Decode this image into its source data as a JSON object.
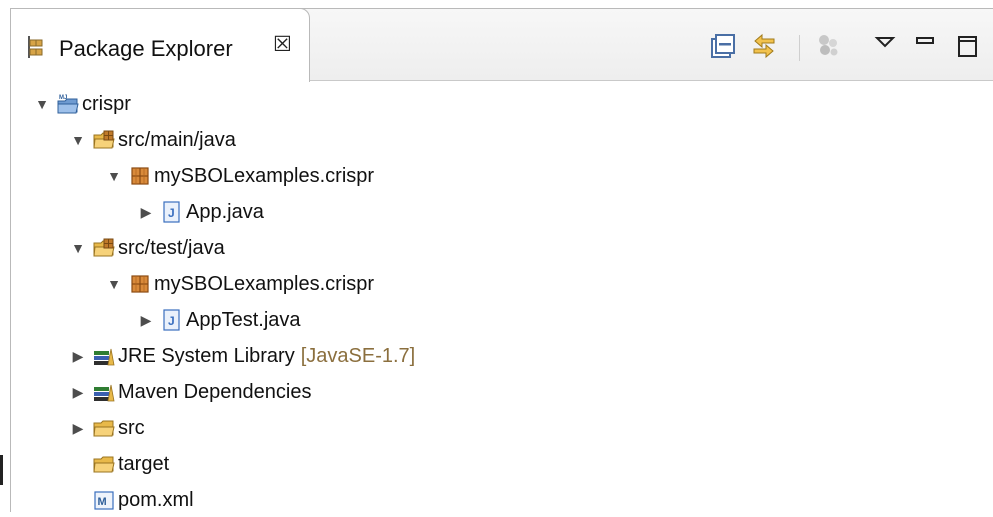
{
  "view": {
    "title": "Package Explorer",
    "close_glyph": "☒",
    "toolbar": {
      "collapse_all_icon": "collapse-all-icon",
      "link_with_editor_icon": "link-with-editor-icon",
      "select_working_set_icon": "working-set-icon",
      "view_menu_icon": "view-menu-icon",
      "minimize_icon": "minimize-icon",
      "maximize_icon": "maximize-icon"
    }
  },
  "tree": {
    "project": {
      "label": "crispr",
      "expanded": true,
      "icon": "maven-project-icon"
    },
    "src_main_java": {
      "label": "src/main/java",
      "expanded": true,
      "icon": "source-folder-icon"
    },
    "main_package": {
      "label": "mySBOLexamples.crispr",
      "expanded": true,
      "icon": "package-icon"
    },
    "app_java": {
      "label": "App.java",
      "expanded": false,
      "icon": "java-file-icon"
    },
    "src_test_java": {
      "label": "src/test/java",
      "expanded": true,
      "icon": "source-folder-icon"
    },
    "test_package": {
      "label": "mySBOLexamples.crispr",
      "expanded": true,
      "icon": "package-icon"
    },
    "apptest_java": {
      "label": "AppTest.java",
      "expanded": false,
      "icon": "java-file-icon"
    },
    "jre_library": {
      "label": "JRE System Library",
      "decoration": "[JavaSE-1.7]",
      "expanded": false,
      "icon": "library-icon"
    },
    "maven_deps": {
      "label": "Maven Dependencies",
      "expanded": false,
      "icon": "library-icon"
    },
    "src": {
      "label": "src",
      "expanded": false,
      "icon": "folder-icon"
    },
    "target": {
      "label": "target",
      "icon": "folder-icon"
    },
    "pom": {
      "label": "pom.xml",
      "icon": "maven-pom-icon"
    }
  },
  "twisty": {
    "expanded": "▼",
    "collapsed": "▶"
  },
  "colors": {
    "decoration": "#8b6f3e",
    "folder": "#e8b94a",
    "package": "#b5651d",
    "java": "#3a6fbf"
  }
}
